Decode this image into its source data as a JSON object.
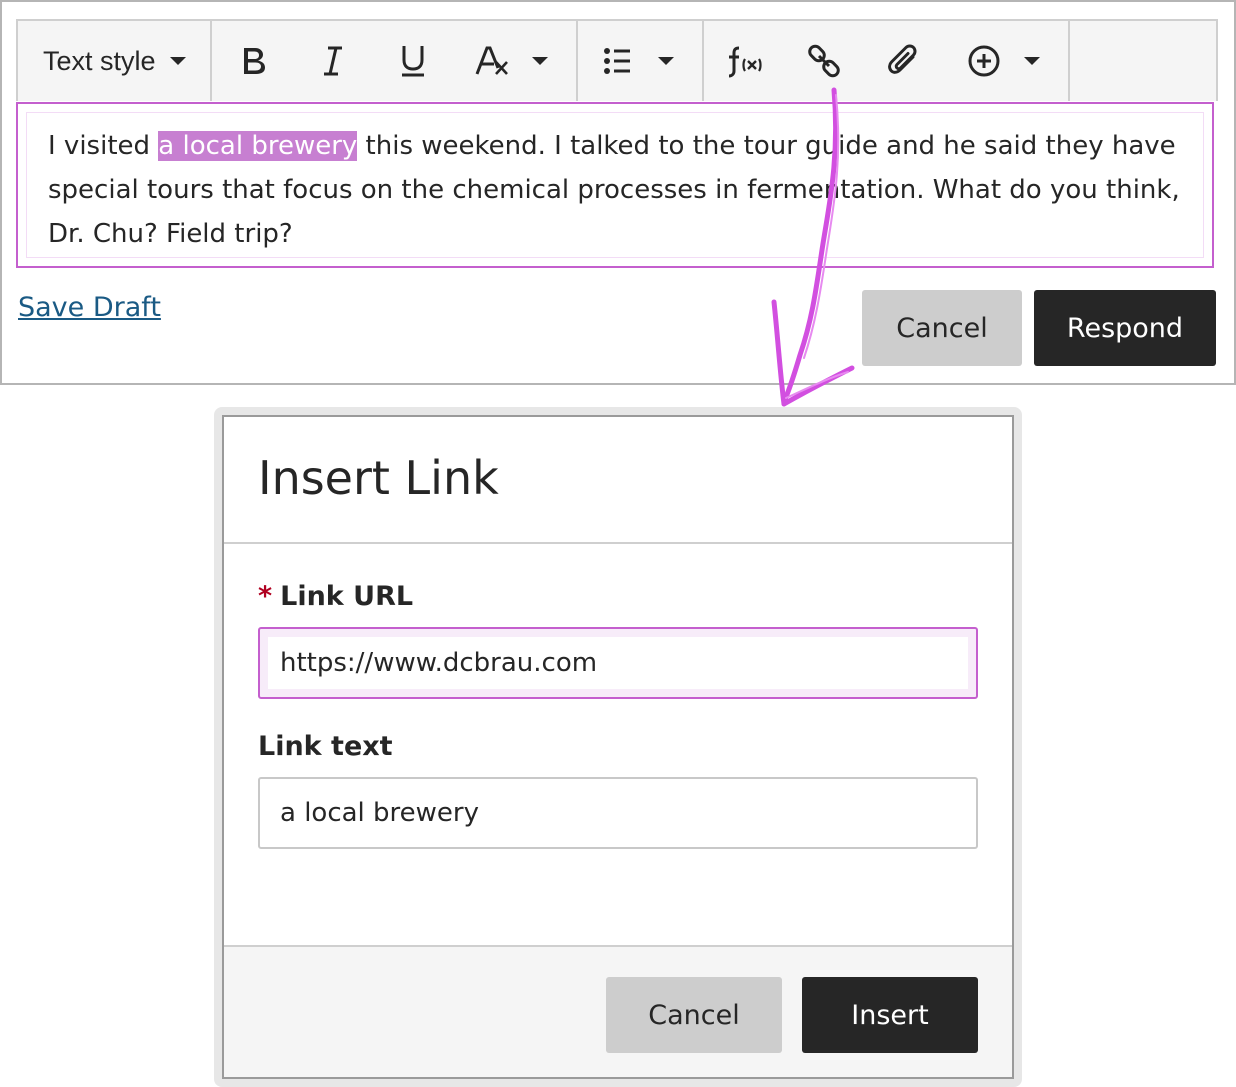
{
  "editor": {
    "toolbar": {
      "text_style_label": "Text style",
      "icons": {
        "bold": "bold-icon",
        "italic": "italic-icon",
        "underline": "underline-icon",
        "font_format": "font-format-icon",
        "bullet_list": "bullet-list-icon",
        "math": "math-formula-icon",
        "link": "link-icon",
        "attachment": "paperclip-icon",
        "insert_content": "add-circle-icon"
      }
    },
    "content": {
      "before": "I visited ",
      "highlighted": "a local brewery",
      "after": " this weekend. I talked to the tour guide and he said they have special tours that focus on the chemical processes in fermentation. What do you think, Dr. Chu? Field trip?"
    },
    "save_draft": "Save Draft",
    "cancel_label": "Cancel",
    "respond_label": "Respond"
  },
  "dialog": {
    "title": "Insert Link",
    "required_marker": "*",
    "url_label": "Link URL",
    "url_value": "https://www.dcbrau.com",
    "text_label": "Link text",
    "text_value": "a local brewery",
    "cancel_label": "Cancel",
    "insert_label": "Insert"
  },
  "colors": {
    "accent_magenta": "#c45fce",
    "highlight": "#c77fd1",
    "primary_button": "#262626",
    "secondary_button": "#cdcdcd",
    "link": "#1a5a84",
    "required": "#b00020"
  }
}
